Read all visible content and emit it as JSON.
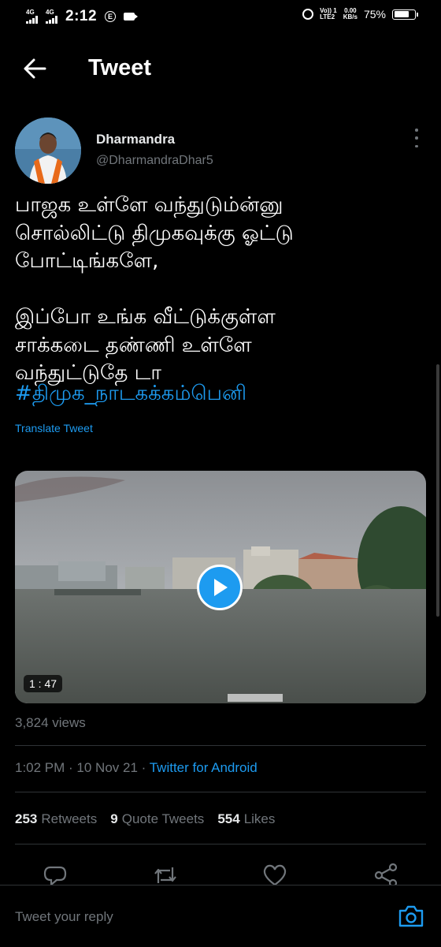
{
  "status_bar": {
    "sim1": "4G",
    "sim2": "4G",
    "time": "2:12",
    "indicator_e": "E",
    "volte_line1": "Vo)) 1",
    "volte_line2": "LTE2",
    "speed_line1": "0.00",
    "speed_line2": "KB/s",
    "battery_percent": "75%",
    "battery_level": 0.75
  },
  "header": {
    "title": "Tweet"
  },
  "tweet": {
    "author_name": "Dharmandra",
    "author_handle": "@DharmandraDhar5",
    "text": "பாஜக உள்ளே வந்துடும்ன்னு\nசொல்லிட்டு திமுகவுக்கு ஓட்டு\nபோட்டிங்களே,\n\nஇப்போ உங்க வீட்டுக்குள்ள\nசாக்கடை தண்ணி உள்ளே\nவந்துட்டுதே டா",
    "hashtag": "#திமுக_நாடகக்கம்பெனி",
    "translate_label": "Translate Tweet",
    "video_duration": "1 : 47",
    "views": "3,824 views",
    "time": "1:02 PM",
    "date": "10 Nov 21",
    "separator": " · ",
    "source": "Twitter for Android",
    "retweets_count": "253",
    "retweets_label": "Retweets",
    "quotes_count": "9",
    "quotes_label": "Quote Tweets",
    "likes_count": "554",
    "likes_label": "Likes"
  },
  "reply": {
    "placeholder": "Tweet your reply"
  },
  "colors": {
    "background": "#000000",
    "accent": "#1d9bf0",
    "secondary_text": "#71767b",
    "divider": "#2f3336"
  },
  "icons": [
    "back-arrow-icon",
    "more-vertical-icon",
    "play-icon",
    "reply-icon",
    "retweet-icon",
    "like-icon",
    "share-icon",
    "camera-icon"
  ]
}
